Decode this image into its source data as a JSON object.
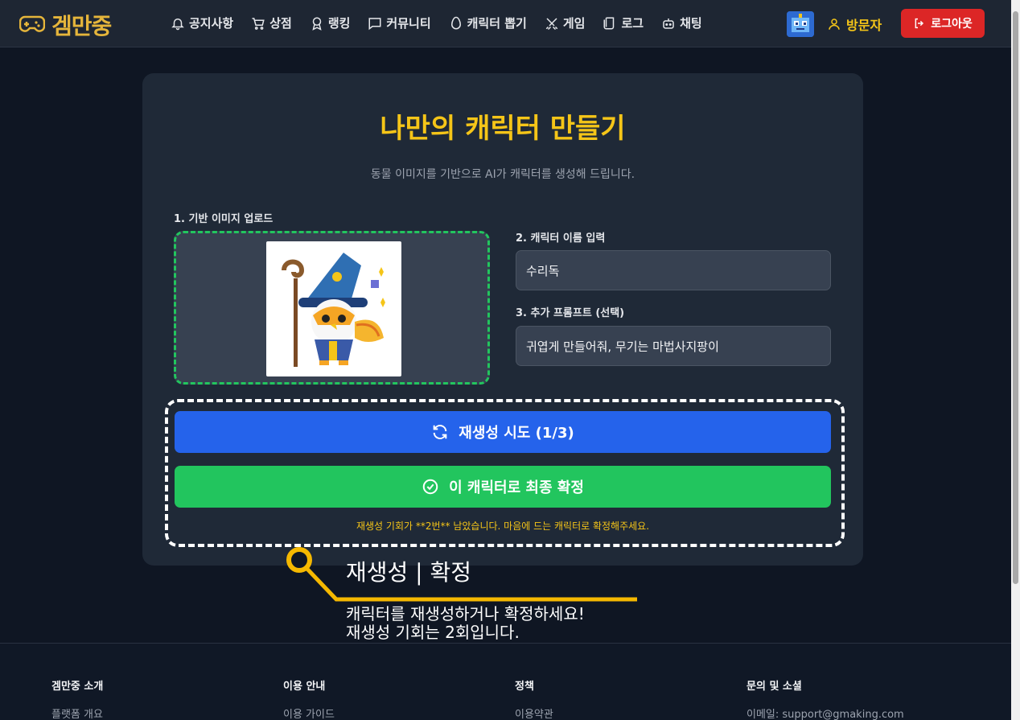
{
  "header": {
    "logo": "겜만중",
    "nav": [
      {
        "label": "공지사항",
        "icon": "bell-icon"
      },
      {
        "label": "상점",
        "icon": "cart-icon"
      },
      {
        "label": "랭킹",
        "icon": "medal-icon"
      },
      {
        "label": "커뮤니티",
        "icon": "chat-icon"
      },
      {
        "label": "캐릭터 뽑기",
        "icon": "egg-icon"
      },
      {
        "label": "게임",
        "icon": "swords-icon"
      },
      {
        "label": "로그",
        "icon": "scroll-icon"
      },
      {
        "label": "채팅",
        "icon": "bot-icon"
      }
    ],
    "user_name": "방문자",
    "logout_label": "로그아웃"
  },
  "main": {
    "title": "나만의 캐릭터 만들기",
    "subtitle": "동물 이미지를 기반으로 AI가 캐릭터를 생성해 드립니다.",
    "upload_label": "1. 기반 이미지 업로드",
    "name_label": "2. 캐릭터 이름 입력",
    "name_value": "수리독",
    "prompt_label": "3. 추가 프롬프트 (선택)",
    "prompt_value": "귀엽게 만들어줘, 무기는 마법사지팡이",
    "retry_label": "재생성 시도 (1/3)",
    "confirm_label": "이 캐릭터로 최종 확정",
    "hint": "재생성 기회가 **2번** 남았습니다. 마음에 드는 캐릭터로 확정해주세요."
  },
  "callout": {
    "title": "재생성 | 확정",
    "line1": "캐릭터를 재생성하거나 확정하세요!",
    "line2": "재생성 기회는 2회입니다."
  },
  "footer": {
    "cols": [
      {
        "head": "겜만중 소개",
        "link": "플랫폼 개요"
      },
      {
        "head": "이용 안내",
        "link": "이용 가이드"
      },
      {
        "head": "정책",
        "link": "이용약관"
      },
      {
        "head": "문의 및 소셜",
        "link": "이메일: support@gmaking.com"
      }
    ]
  },
  "colors": {
    "accent": "#f5c518",
    "retry": "#2563eb",
    "confirm": "#22c55e",
    "logout": "#dc2626"
  }
}
